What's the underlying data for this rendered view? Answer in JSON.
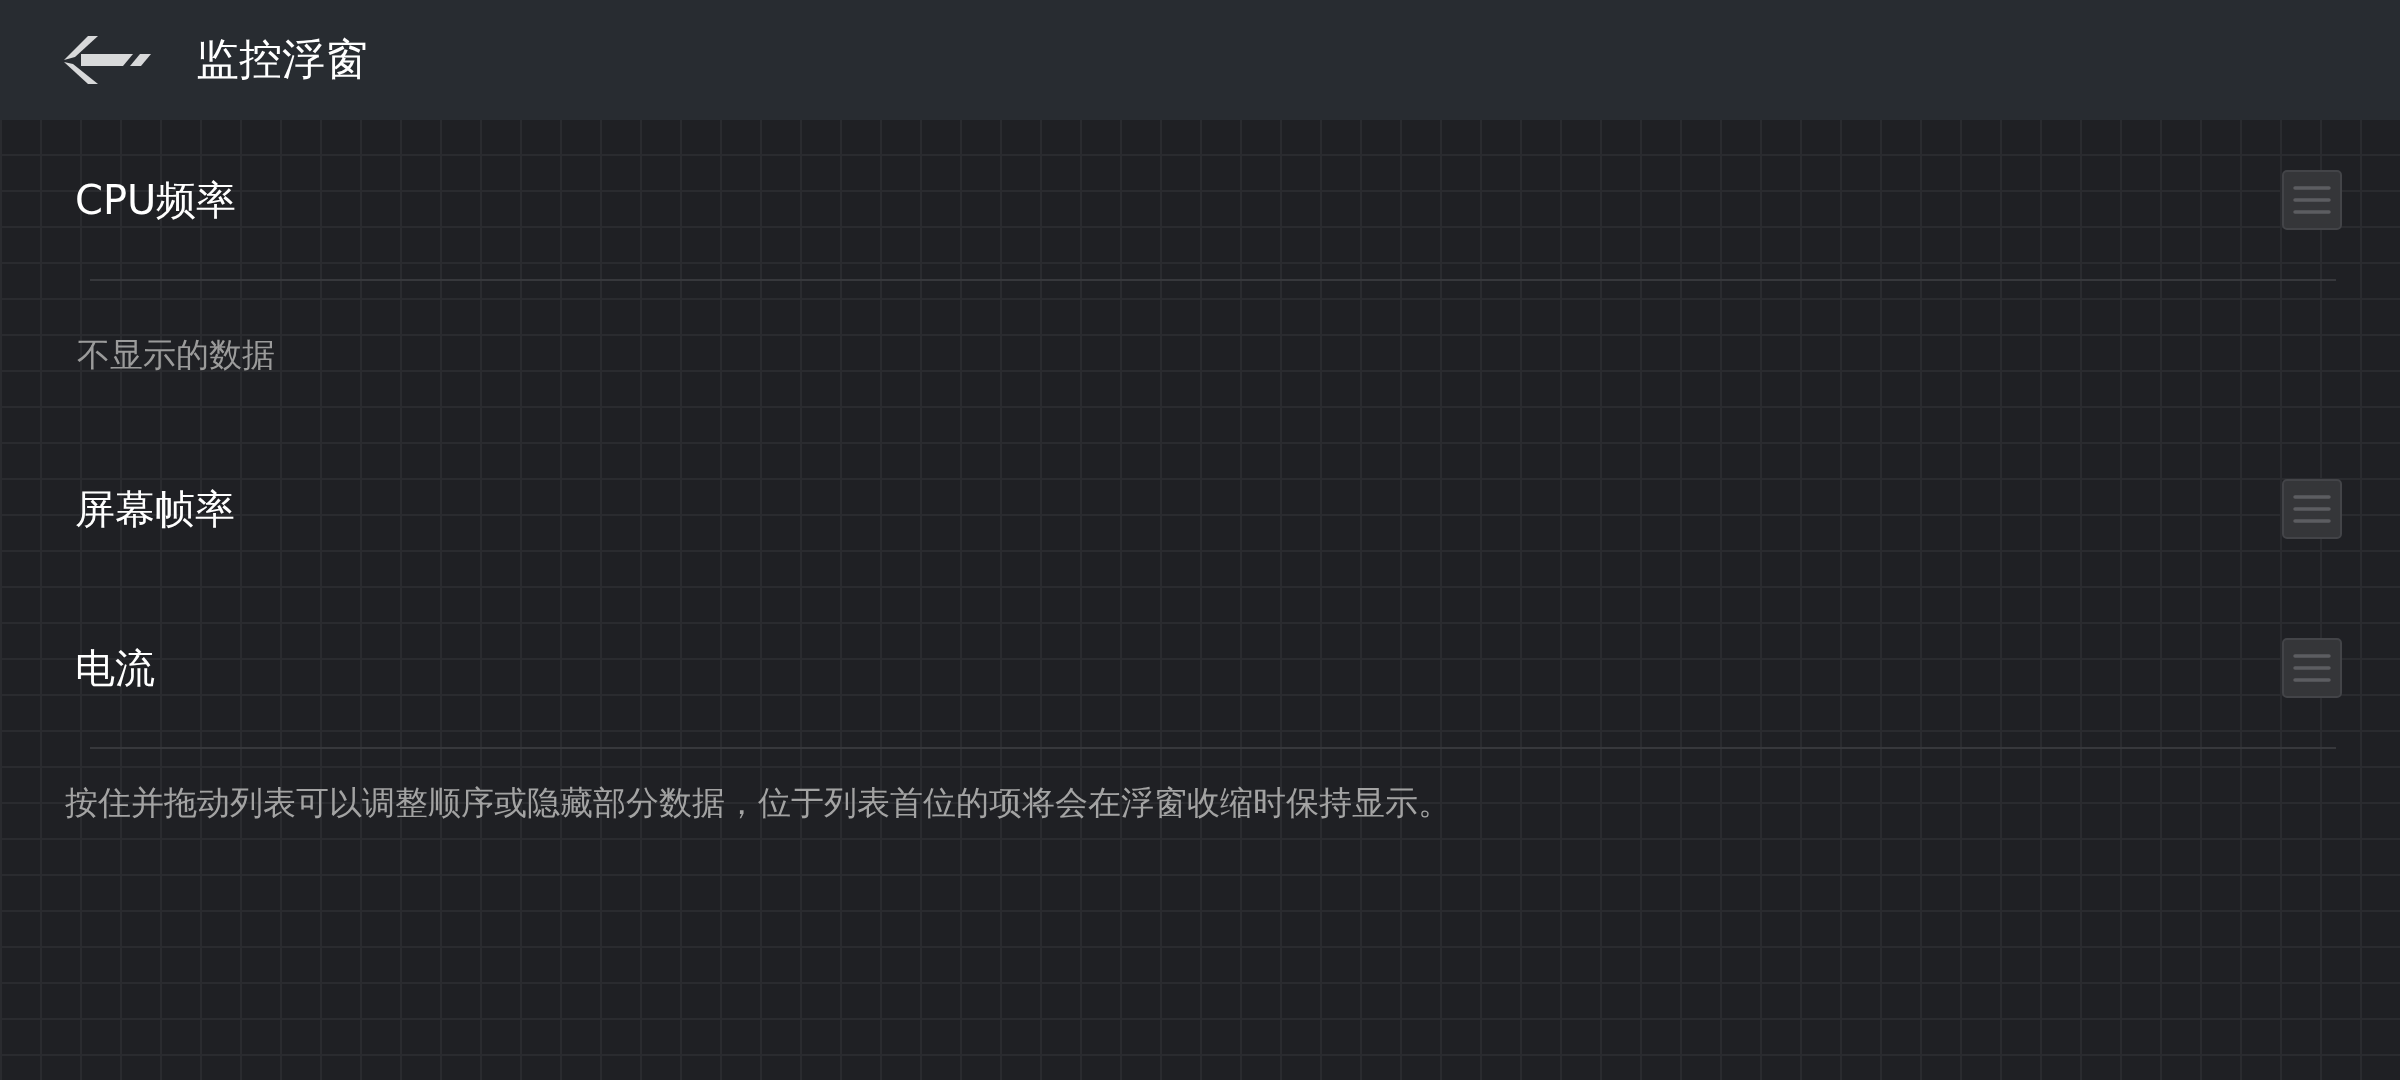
{
  "header": {
    "title": "监控浮窗"
  },
  "shown_items": [
    {
      "label": "CPU频率"
    }
  ],
  "hidden_section": {
    "title": "不显示的数据",
    "items": [
      {
        "label": "屏幕帧率"
      },
      {
        "label": "电流"
      }
    ]
  },
  "hint": "按住并拖动列表可以调整顺序或隐藏部分数据，位于列表首位的项将会在浮窗收缩时保持显示。"
}
